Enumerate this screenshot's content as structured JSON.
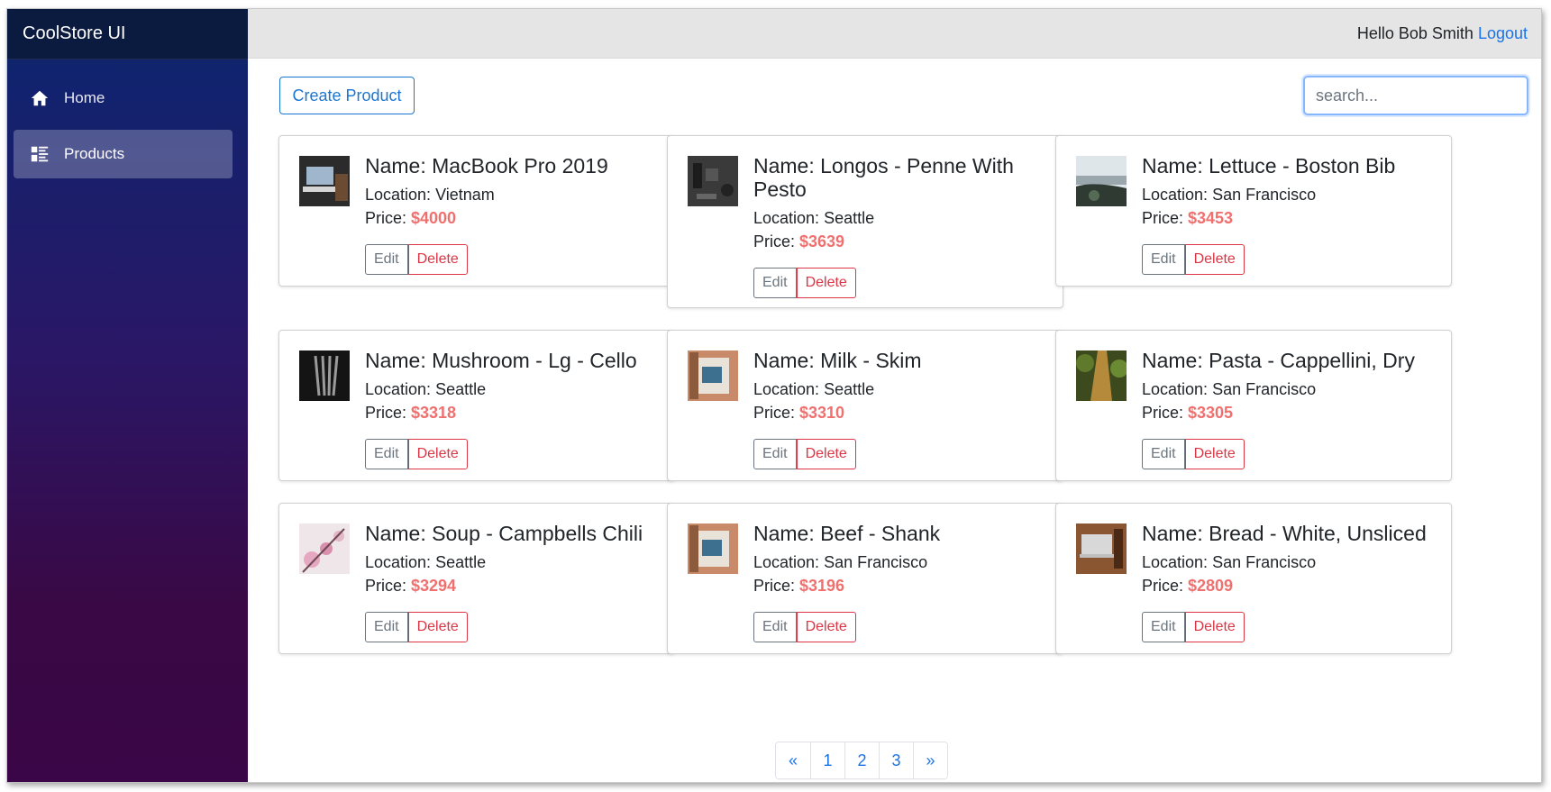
{
  "app": {
    "title": "CoolStore UI"
  },
  "sidebar": {
    "items": [
      {
        "label": "Home",
        "icon": "home-icon",
        "active": false
      },
      {
        "label": "Products",
        "icon": "list-icon",
        "active": true
      }
    ]
  },
  "header": {
    "greeting": "Hello Bob Smith",
    "logout_label": "Logout"
  },
  "toolbar": {
    "create_label": "Create Product",
    "search_placeholder": "search...",
    "search_value": ""
  },
  "labels": {
    "name_prefix": "Name: ",
    "location_prefix": "Location: ",
    "price_prefix": "Price: ",
    "edit": "Edit",
    "delete": "Delete"
  },
  "products": [
    {
      "name": "MacBook Pro 2019",
      "location": "Vietnam",
      "price": "$4000"
    },
    {
      "name": "Longos - Penne With Pesto",
      "location": "Seattle",
      "price": "$3639"
    },
    {
      "name": "Lettuce - Boston Bib",
      "location": "San Francisco",
      "price": "$3453"
    },
    {
      "name": "Mushroom - Lg - Cello",
      "location": "Seattle",
      "price": "$3318"
    },
    {
      "name": "Milk - Skim",
      "location": "Seattle",
      "price": "$3310"
    },
    {
      "name": "Pasta - Cappellini, Dry",
      "location": "San Francisco",
      "price": "$3305"
    },
    {
      "name": "Soup - Campbells Chili",
      "location": "Seattle",
      "price": "$3294"
    },
    {
      "name": "Beef - Shank",
      "location": "San Francisco",
      "price": "$3196"
    },
    {
      "name": "Bread - White, Unsliced",
      "location": "San Francisco",
      "price": "$2809"
    }
  ],
  "pagination": {
    "prev": "«",
    "pages": [
      "1",
      "2",
      "3"
    ],
    "next": "»"
  },
  "colors": {
    "price": "#f0706f",
    "link": "#1a73e8",
    "sidebar_top": "#0b2670",
    "sidebar_bottom": "#3a0647"
  }
}
